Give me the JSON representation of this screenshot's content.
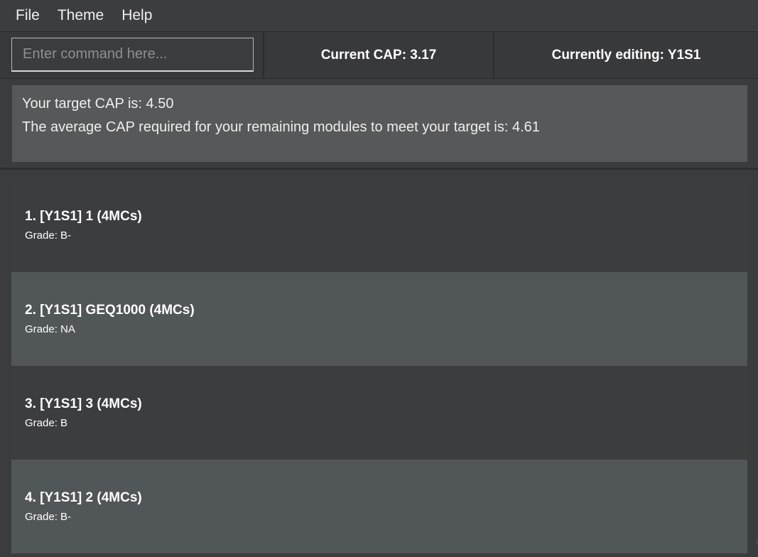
{
  "menu": {
    "items": [
      "File",
      "Theme",
      "Help"
    ]
  },
  "command": {
    "placeholder": "Enter command here...",
    "value": ""
  },
  "status": {
    "current_cap": "Current CAP: 3.17",
    "currently_editing": "Currently editing: Y1S1"
  },
  "target": {
    "line1": "Your target CAP is: 4.50",
    "line2": "The average CAP required for your remaining modules to meet your target is: 4.61"
  },
  "modules": [
    {
      "title": "1.  [Y1S1] 1 (4MCs)",
      "grade": "Grade: B-"
    },
    {
      "title": "2.  [Y1S1] GEQ1000 (4MCs)",
      "grade": "Grade: NA"
    },
    {
      "title": "3.  [Y1S1] 3 (4MCs)",
      "grade": "Grade: B"
    },
    {
      "title": "4.  [Y1S1] 2 (4MCs)",
      "grade": "Grade: B-"
    }
  ]
}
